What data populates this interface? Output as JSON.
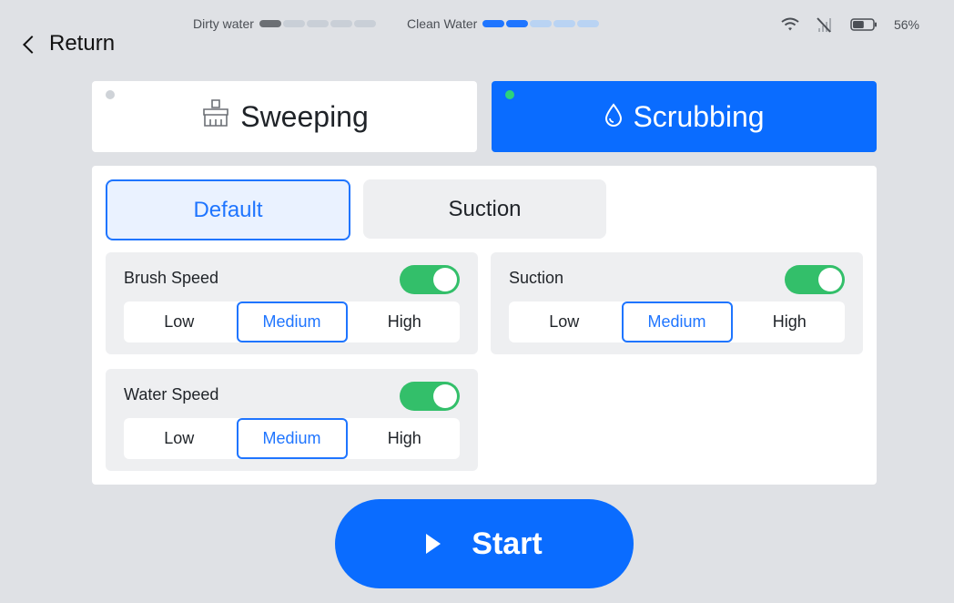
{
  "header": {
    "return_label": "Return",
    "dirty_water_label": "Dirty water",
    "clean_water_label": "Clean Water",
    "dirty_level": 0.25,
    "clean_level": 0.4,
    "battery_text": "56%",
    "battery_level": 0.56
  },
  "modes": {
    "sweeping_label": "Sweeping",
    "scrubbing_label": "Scrubbing",
    "selected": "Scrubbing"
  },
  "tabs": {
    "default_label": "Default",
    "suction_label": "Suction",
    "selected": "Default"
  },
  "settings": {
    "brush_speed": {
      "title": "Brush Speed",
      "enabled": true,
      "options": [
        "Low",
        "Medium",
        "High"
      ],
      "selected": "Medium"
    },
    "suction": {
      "title": "Suction",
      "enabled": true,
      "options": [
        "Low",
        "Medium",
        "High"
      ],
      "selected": "Medium"
    },
    "water_speed": {
      "title": "Water Speed",
      "enabled": true,
      "options": [
        "Low",
        "Medium",
        "High"
      ],
      "selected": "Medium"
    }
  },
  "start_label": "Start",
  "colors": {
    "accent": "#0a6cff",
    "toggle_on": "#33bf6a",
    "indicator_active": "#2dd27a",
    "indicator_inactive": "#cfd3d8"
  },
  "icons": {
    "back": "chevron-left-icon",
    "wifi": "wifi-icon",
    "signal": "no-signal-icon",
    "battery": "battery-icon",
    "sweeping": "broom-icon",
    "scrubbing": "water-drop-icon",
    "start": "play-icon"
  }
}
